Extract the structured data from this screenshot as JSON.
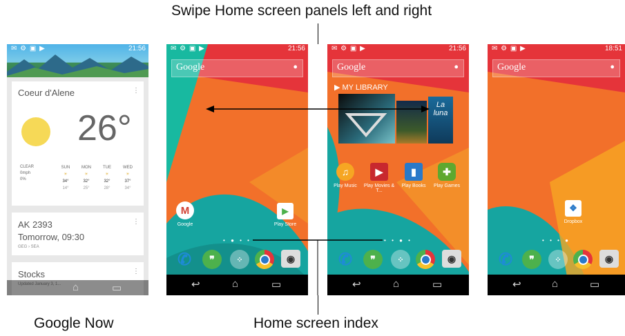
{
  "captions": {
    "top": "Swipe Home screen panels left and right",
    "google_now": "Google Now",
    "index": "Home screen index"
  },
  "status": {
    "p1_time": "21:56",
    "p2_time": "21:56",
    "p3_time": "21:56",
    "p4_time": "18:51",
    "left_icons": "✉ ⚙ ▣ ▶"
  },
  "search": {
    "logo": "Google",
    "mic": "🎤"
  },
  "google_now": {
    "weather": {
      "city": "Coeur d'Alene",
      "temp": "26°",
      "condition": "CLEAR",
      "wind": "0mph",
      "precip": "0%",
      "days": [
        {
          "day": "SUN",
          "hi": "34°",
          "lo": "14°"
        },
        {
          "day": "MON",
          "hi": "32°",
          "lo": "25°"
        },
        {
          "day": "TUE",
          "hi": "32°",
          "lo": "28°"
        },
        {
          "day": "WED",
          "hi": "37°",
          "lo": "34°"
        }
      ]
    },
    "flight": {
      "title": "AK 2393",
      "time": "Tomorrow, 09:30",
      "route": "GEG › SEA"
    },
    "stocks": {
      "title": "Stocks",
      "updated": "Updated January 3, 1..."
    }
  },
  "apps": {
    "gmail": "Google",
    "play_store": "Play Store",
    "play_music": "Play Music",
    "play_movies": "Play Movies & T...",
    "play_books": "Play Books",
    "play_games": "Play Games",
    "dropbox": "Dropbox"
  },
  "library": {
    "label": "MY LIBRARY",
    "cover_text": "La luna"
  },
  "nav": {
    "back": "↩",
    "home": "⌂",
    "recent": "▭"
  },
  "colors": {
    "red": "#e5343a",
    "orange": "#f4842a",
    "teal": "#16a5a0",
    "green": "#4db14c",
    "blue": "#2979c9"
  }
}
